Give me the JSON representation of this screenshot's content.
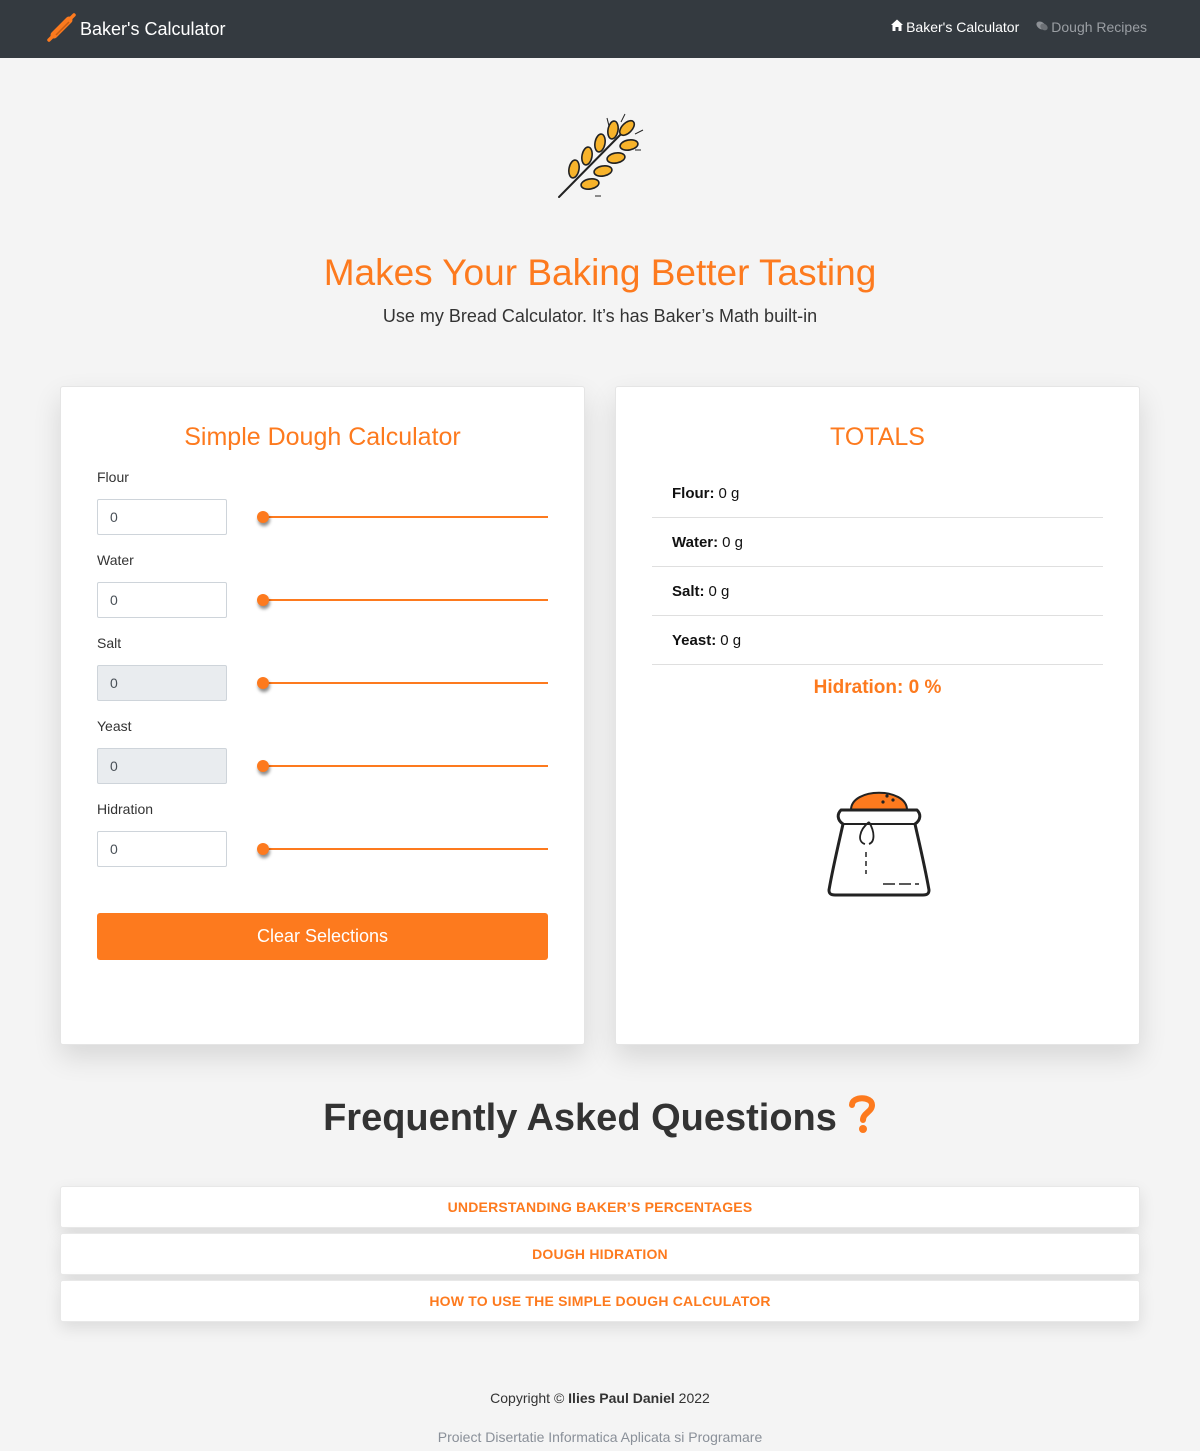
{
  "navbar": {
    "brand": "Baker's Calculator",
    "links": [
      {
        "label": "Baker's Calculator",
        "icon": "home-icon",
        "active": true
      },
      {
        "label": "Dough Recipes",
        "icon": "bread-icon",
        "active": false
      }
    ]
  },
  "hero": {
    "icon": "wheat-icon",
    "title": "Makes Your Baking Better Tasting",
    "subtitle": "Use my Bread Calculator. It’s has Baker’s Math built-in"
  },
  "calculator": {
    "title": "Simple Dough Calculator",
    "fields": [
      {
        "label": "Flour",
        "value": "0",
        "disabled": false,
        "slider_fraction": 0
      },
      {
        "label": "Water",
        "value": "0",
        "disabled": false,
        "slider_fraction": 0
      },
      {
        "label": "Salt",
        "value": "0",
        "disabled": true,
        "slider_fraction": 0
      },
      {
        "label": "Yeast",
        "value": "0",
        "disabled": true,
        "slider_fraction": 0
      },
      {
        "label": "Hidration",
        "value": "0",
        "disabled": false,
        "slider_fraction": 0
      }
    ],
    "clear_label": "Clear Selections"
  },
  "totals": {
    "title": "TOTALS",
    "items": [
      {
        "label": "Flour:",
        "value": "0 g"
      },
      {
        "label": "Water:",
        "value": "0 g"
      },
      {
        "label": "Salt:",
        "value": "0 g"
      },
      {
        "label": "Yeast:",
        "value": "0 g"
      }
    ],
    "hydration": "Hidration: 0 %",
    "icon": "flour-bag-icon"
  },
  "faq": {
    "title": "Frequently Asked Questions",
    "icon": "question-icon",
    "items": [
      "UNDERSTANDING BAKER’S PERCENTAGES",
      "DOUGH HIDRATION",
      "HOW TO USE THE SIMPLE DOUGH CALCULATOR"
    ]
  },
  "footer": {
    "copyright_prefix": "Copyright ©",
    "author": "Ilies Paul Daniel",
    "year": "2022",
    "subtitle": "Proiect Disertatie Informatica Aplicata si Programare"
  },
  "colors": {
    "accent": "#fd7a1e",
    "navbar": "#343a40",
    "background": "#f4f4f4"
  }
}
